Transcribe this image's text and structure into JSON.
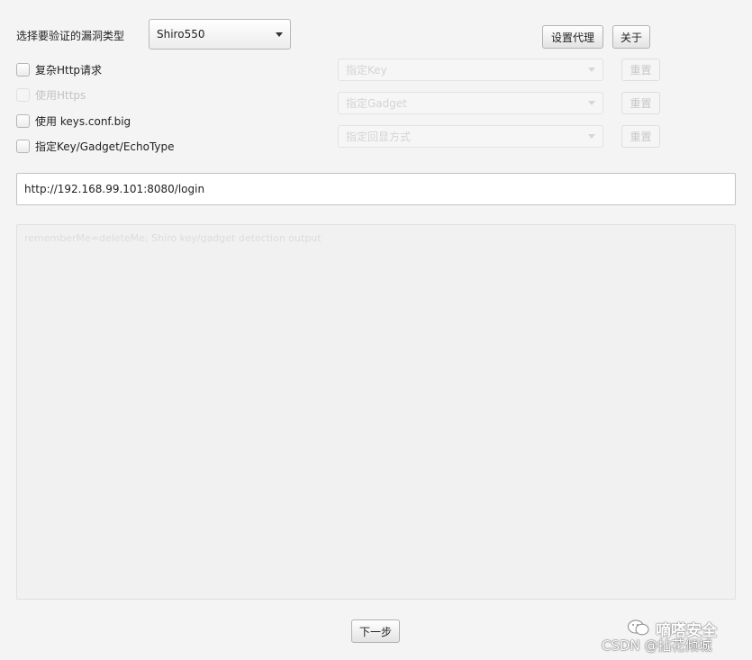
{
  "header": {
    "vuln_type_label": "选择要验证的漏洞类型",
    "vuln_type_value": "Shiro550",
    "proxy_button": "设置代理",
    "about_button": "关于"
  },
  "options": {
    "complex_http": "复杂Http请求",
    "use_https": "使用Https",
    "use_keys_conf": "使用 keys.conf.big",
    "specify_key_gadget": "指定Key/Gadget/EchoType"
  },
  "selectors": {
    "key_placeholder": "指定Key",
    "gadget_placeholder": "指定Gadget",
    "echo_placeholder": "指定回显方式",
    "reset_label": "重置"
  },
  "target": {
    "url": "http://192.168.99.101:8080/login"
  },
  "output": {
    "placeholder": "rememberMe=deleteMe; Shiro key/gadget detection output"
  },
  "footer": {
    "next_button": "下一步"
  },
  "watermark": {
    "line1": "嘀嗒安全",
    "line2": "CSDN @拈花倾城"
  }
}
